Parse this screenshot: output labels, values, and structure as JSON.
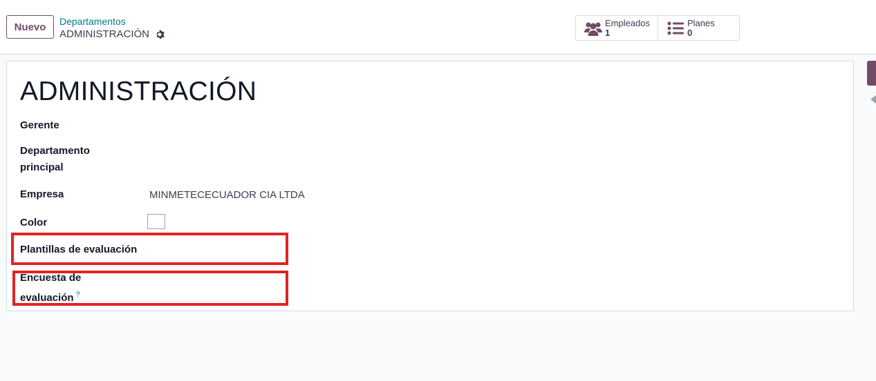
{
  "toolbar": {
    "new_label": "Nuevo"
  },
  "breadcrumb": {
    "parent": "Departamentos",
    "current": "ADMINISTRACIÓN"
  },
  "smart_buttons": [
    {
      "label": "Empleados",
      "value": "1",
      "icon": "users-icon"
    },
    {
      "label": "Planes",
      "value": "0",
      "icon": "list-icon"
    }
  ],
  "record": {
    "title": "ADMINISTRACIÓN",
    "fields": {
      "manager": {
        "label": "Gerente",
        "value": ""
      },
      "parent_department": {
        "label_line1": "Departamento",
        "label_line2": "principal",
        "value": ""
      },
      "company": {
        "label": "Empresa",
        "value": "MINMETECECUADOR CIA LTDA"
      },
      "color": {
        "label": "Color"
      },
      "appraisal_templates": {
        "label": "Plantillas de evaluación",
        "value": ""
      },
      "appraisal_survey": {
        "label_line1": "Encuesta de",
        "label_line2": "evaluación",
        "help": "?",
        "value": ""
      }
    }
  },
  "colors": {
    "brand": "#714b67",
    "link": "#017e84",
    "highlight": "#e02424"
  }
}
